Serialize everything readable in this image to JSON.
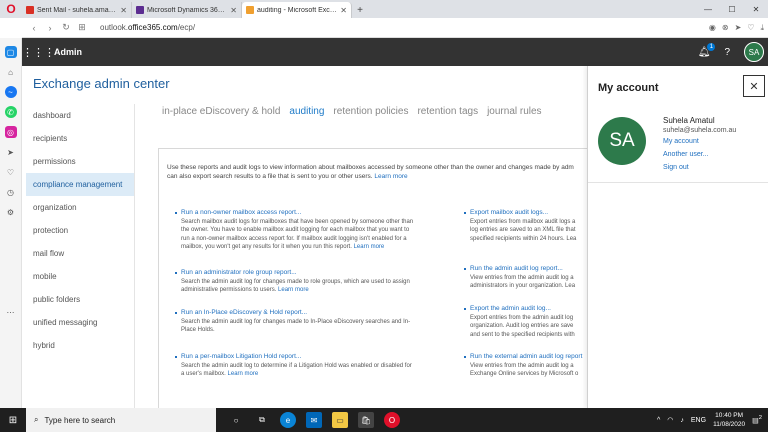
{
  "browser": {
    "tabs": [
      {
        "label": "Sent Mail - suhela.amatul@",
        "icon_color": "#d93025"
      },
      {
        "label": "Microsoft Dynamics 365 Co",
        "icon_color": "#5c2d91"
      },
      {
        "label": "auditing - Microsoft Exchan",
        "icon_color": "#f0a030"
      }
    ],
    "url_prefix": "outlook.",
    "url_domain": "office365.com",
    "url_path": "/ecp/"
  },
  "o365": {
    "app_name": "Admin",
    "notif_count": "1",
    "help": "?",
    "avatar_initials": "SA"
  },
  "eac": {
    "title": "Exchange admin center",
    "nav": [
      "dashboard",
      "recipients",
      "permissions",
      "compliance management",
      "organization",
      "protection",
      "mail flow",
      "mobile",
      "public folders",
      "unified messaging",
      "hybrid"
    ],
    "active_nav": 3,
    "tabs": [
      "in-place eDiscovery & hold",
      "auditing",
      "retention policies",
      "retention tags",
      "journal rules"
    ],
    "active_tab": 1,
    "intro": "Use these reports and audit logs to view information about mailboxes accessed by someone other than the owner and changes made by adm",
    "intro2": "can also export search results to a file that is sent to you or other users.",
    "learn_more": "Learn more",
    "left_reports": [
      {
        "title": "Run a non-owner mailbox access report...",
        "lines": [
          "Search mailbox audit logs for mailboxes that have been opened by someone other than",
          "the owner. You have to enable mailbox audit logging for each mailbox that you want to",
          "run a non-owner mailbox access report for. If mailbox audit logging isn't enabled for a",
          "mailbox, you won't get any results for it when you run this report."
        ]
      },
      {
        "title": "Run an administrator role group report...",
        "lines": [
          "Search the admin audit log for changes made to role groups, which are used to assign",
          "administrative permissions to users."
        ]
      },
      {
        "title": "Run an In-Place eDiscovery & Hold report...",
        "lines": [
          "Search the admin audit log for changes made to In-Place eDiscovery searches and In-",
          "Place Holds."
        ]
      },
      {
        "title": "Run a per-mailbox Litigation Hold report...",
        "lines": [
          "Search the admin audit log to determine if a Litigation Hold was enabled or disabled for",
          "a user's mailbox."
        ]
      }
    ],
    "right_reports": [
      {
        "title": "Export mailbox audit logs...",
        "lines": [
          "Export entries from mailbox audit logs a",
          "log entries are saved to an XML file that",
          "specified recipients within 24 hours. Lea"
        ]
      },
      {
        "title": "Run the admin audit log report...",
        "lines": [
          "View entries from the admin audit log a",
          "administrators in your organization. Lea"
        ]
      },
      {
        "title": "Export the admin audit log...",
        "lines": [
          "Export entries from the admin audit log",
          "organization. Audit log entries are save",
          "and sent to the specified recipients with"
        ]
      },
      {
        "title": "Run the external admin audit log report",
        "lines": [
          "View entries from the admin audit log a",
          "Exchange Online services by Microsoft o"
        ]
      }
    ]
  },
  "account": {
    "title": "My account",
    "initials": "SA",
    "name": "Suhela Amatul",
    "email": "suhela@suhela.com.au",
    "links": [
      "My account",
      "Another user...",
      "Sign out"
    ]
  },
  "taskbar": {
    "search_placeholder": "Type here to search",
    "lang": "ENG",
    "time": "10:40 PM",
    "date": "11/08/2020",
    "notif": "2"
  }
}
